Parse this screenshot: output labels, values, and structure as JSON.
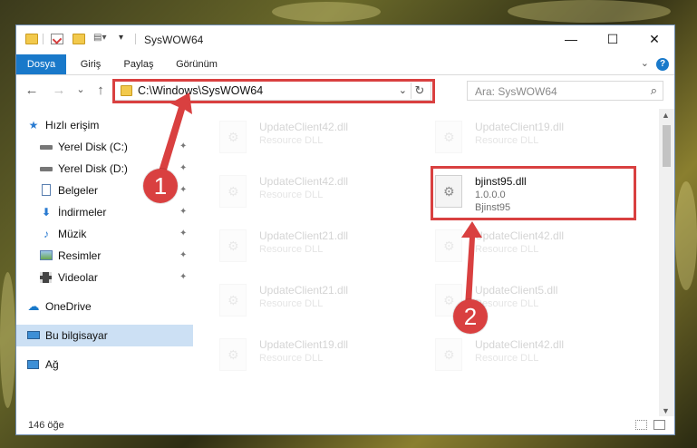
{
  "window": {
    "title": "SysWOW64",
    "minimize": "—",
    "maximize": "☐",
    "close": "✕"
  },
  "ribbon": {
    "tabs": [
      "Dosya",
      "Giriş",
      "Paylaş",
      "Görünüm"
    ],
    "help": "?",
    "collapse": "⌄"
  },
  "nav": {
    "back": "←",
    "forward": "→",
    "recent": "⌄",
    "up": "↑",
    "address": "C:\\Windows\\SysWOW64",
    "address_dropdown": "⌄",
    "refresh": "↻",
    "search_placeholder": "Ara: SysWOW64",
    "search_icon": "⌕"
  },
  "sidebar": {
    "items": [
      {
        "label": "Hızlı erişim",
        "icon": "star-icon"
      },
      {
        "label": "Yerel Disk (C:)",
        "icon": "drive-icon",
        "pinned": true
      },
      {
        "label": "Yerel Disk (D:)",
        "icon": "drive-icon",
        "pinned": true
      },
      {
        "label": "Belgeler",
        "icon": "document-icon",
        "pinned": true
      },
      {
        "label": "İndirmeler",
        "icon": "download-icon",
        "pinned": true
      },
      {
        "label": "Müzik",
        "icon": "music-icon",
        "pinned": true
      },
      {
        "label": "Resimler",
        "icon": "picture-icon",
        "pinned": true
      },
      {
        "label": "Videolar",
        "icon": "video-icon",
        "pinned": true
      },
      {
        "label": "OneDrive",
        "icon": "cloud-icon"
      },
      {
        "label": "Bu bilgisayar",
        "icon": "computer-icon",
        "selected": true
      },
      {
        "label": "Ağ",
        "icon": "network-icon"
      }
    ],
    "pin_glyph": "📌"
  },
  "files": [
    {
      "name": "UpdateClient42.dll",
      "type": "Resource DLL",
      "faded": true
    },
    {
      "name": "UpdateClient19.dll",
      "type": "Resource DLL",
      "faded": true
    },
    {
      "name": "UpdateClient42.dll",
      "type": "Resource DLL",
      "faded": true
    },
    {
      "name": "bjinst95.dll",
      "version": "1.0.0.0",
      "type": "Bjinst95",
      "faded": false
    },
    {
      "name": "UpdateClient21.dll",
      "type": "Resource DLL",
      "faded": true
    },
    {
      "name": "UpdateClient42.dll",
      "type": "Resource DLL",
      "faded": true
    },
    {
      "name": "UpdateClient21.dll",
      "type": "Resource DLL",
      "faded": true
    },
    {
      "name": "UpdateClient5.dll",
      "type": "Resource DLL",
      "faded": true
    },
    {
      "name": "UpdateClient19.dll",
      "type": "Resource DLL",
      "faded": true
    },
    {
      "name": "UpdateClient42.dll",
      "type": "Resource DLL",
      "faded": true
    }
  ],
  "status": {
    "count": "146 öğe"
  },
  "annotations": {
    "badge1": "1",
    "badge2": "2",
    "highlight_color": "#d94040"
  }
}
